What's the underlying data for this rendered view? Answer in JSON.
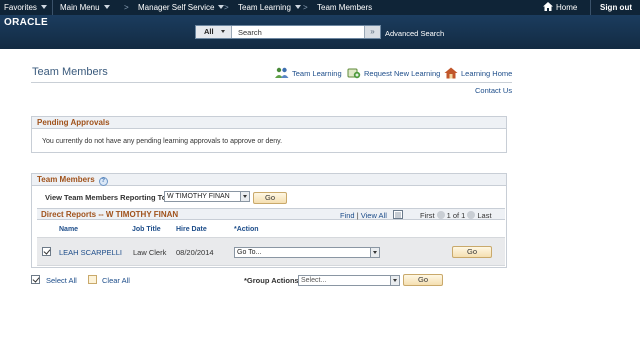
{
  "nav": {
    "favorites": "Favorites",
    "main_menu": "Main Menu",
    "manager_self_service": "Manager Self Service",
    "team_learning": "Team Learning",
    "team_members": "Team Members",
    "home": "Home",
    "sign_out": "Sign out"
  },
  "brand": {
    "logo": "ORACLE"
  },
  "search": {
    "scope": "All",
    "value": "Search",
    "advanced": "Advanced Search"
  },
  "page": {
    "title": "Team Members",
    "links": {
      "team_learning": "Team Learning",
      "request_new_learning": "Request New Learning",
      "learning_home": "Learning Home",
      "contact_us": "Contact Us"
    }
  },
  "pending": {
    "header": "Pending Approvals",
    "message": "You currently do not have any pending learning approvals to approve or deny."
  },
  "team": {
    "header": "Team Members",
    "help_glyph": "?",
    "view_label": "View Team Members Reporting To",
    "view_value": "W TIMOTHY FINAN",
    "go": "Go",
    "grid": {
      "title": "Direct Reports -- W TIMOTHY FINAN",
      "find": "Find",
      "divider": "|",
      "view_all": "View All",
      "first": "First",
      "range": "1 of 1",
      "last": "Last",
      "columns": [
        "Name",
        "Job Title",
        "Hire Date",
        "*Action"
      ],
      "rows": [
        {
          "name": "LEAH SCARPELLI",
          "job_title": "Law Clerk",
          "hire_date": "08/20/2014",
          "action": "Go To...",
          "checked": true,
          "go": "Go"
        }
      ]
    },
    "select_all": "Select All",
    "clear_all": "Clear All",
    "group_actions_label": "*Group Actions",
    "group_actions_value": "Select...",
    "group_go": "Go"
  },
  "colors": {
    "topbar": "#0f2437",
    "banner": "#16324e",
    "link": "#1d4d8a",
    "section_header": "#a0521b",
    "go_button": "#f5dfb1"
  }
}
